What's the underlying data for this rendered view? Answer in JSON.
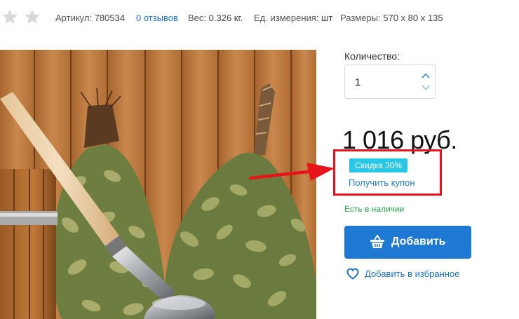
{
  "product_meta": {
    "article_label": "Артикул:",
    "article_value": "780534",
    "reviews_link": "0 отзывов",
    "weight_label": "Вес:",
    "weight_value": "0.326 кг.",
    "unit_label": "Ед. измерения:",
    "unit_value": "шт",
    "size_label": "Размеры:",
    "size_value": "570 x 80 x 135",
    "rating_stars_shown": 2,
    "star_color": "#d9d9d9"
  },
  "purchase": {
    "quantity_label": "Количество:",
    "quantity_value": "1",
    "price": "1 016 руб.",
    "discount_badge": "Скидка 30%",
    "coupon_link": "Получить купон",
    "stock_status": "Есть в наличии",
    "add_button": "Добавить",
    "favorite_link": "Добавить в избранное"
  },
  "colors": {
    "primary": "#1f78d1",
    "link": "#1e73c8",
    "badge": "#29c6e6",
    "in_stock": "#27a64b",
    "annotation": "#e8141c"
  },
  "icons": {
    "rating": "star-icon",
    "quantity_up": "chevron-up-icon",
    "quantity_down": "chevron-down-icon",
    "add_to_cart": "basket-icon",
    "favorite": "heart-icon",
    "annotation": "arrow-icon"
  }
}
